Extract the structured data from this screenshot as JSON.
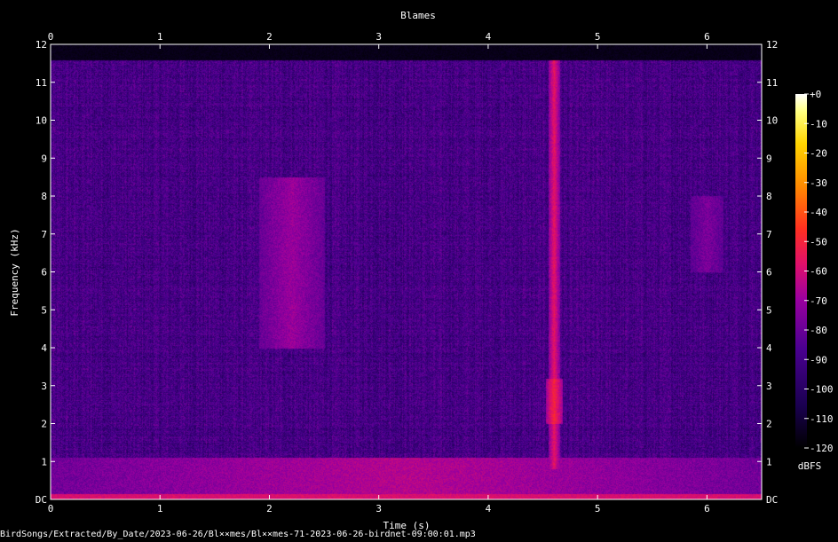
{
  "chart_data": {
    "type": "heatmap",
    "title": "Blames",
    "xlabel": "Time (s)",
    "ylabel": "Frequency (kHz)",
    "xlim": [
      0,
      6.5
    ],
    "ylim": [
      0,
      12
    ],
    "x_ticks": [
      "0",
      "1",
      "2",
      "3",
      "4",
      "5",
      "6"
    ],
    "y_ticks": [
      "DC",
      "1",
      "2",
      "3",
      "4",
      "5",
      "6",
      "7",
      "8",
      "9",
      "10",
      "11",
      "12"
    ],
    "colorbar": {
      "label": "dBFS",
      "range": [
        -120,
        0
      ],
      "ticks": [
        "+0",
        "-10",
        "-20",
        "-30",
        "-40",
        "-50",
        "-60",
        "-70",
        "-80",
        "-90",
        "-100",
        "-110",
        "-120"
      ],
      "colormap": [
        "#000000",
        "#1a0050",
        "#4a0090",
        "#9a00a0",
        "#e0106a",
        "#ff3020",
        "#ff8a00",
        "#ffd400",
        "#ffff80",
        "#ffffff"
      ]
    },
    "background_level_dbfs": -95,
    "energy_cutoff_khz": 11.6,
    "events": [
      {
        "name": "vertical harmonic bursts",
        "t_start": 1.9,
        "t_end": 2.5,
        "f_low": 4.0,
        "f_high": 8.5,
        "level_dbfs": -80
      },
      {
        "name": "broadband click",
        "t_start": 4.55,
        "t_end": 4.65,
        "f_low": 0.8,
        "f_high": 11.6,
        "level_dbfs": -65
      },
      {
        "name": "strong low band",
        "t_start": 4.52,
        "t_end": 4.68,
        "f_low": 2.0,
        "f_high": 3.2,
        "level_dbfs": -58
      },
      {
        "name": "faint sweep",
        "t_start": 5.85,
        "t_end": 6.15,
        "f_low": 6.0,
        "f_high": 8.0,
        "level_dbfs": -85
      },
      {
        "name": "low-frequency noise floor",
        "t_start": 0,
        "t_end": 6.5,
        "f_low": 0,
        "f_high": 1.1,
        "level_dbfs": -75
      }
    ]
  },
  "footer": {
    "path": "BirdSongs/Extracted/By_Date/2023-06-26/Bl××mes/Bl××mes-71-2023-06-26-birdnet-09:00:01.mp3"
  }
}
